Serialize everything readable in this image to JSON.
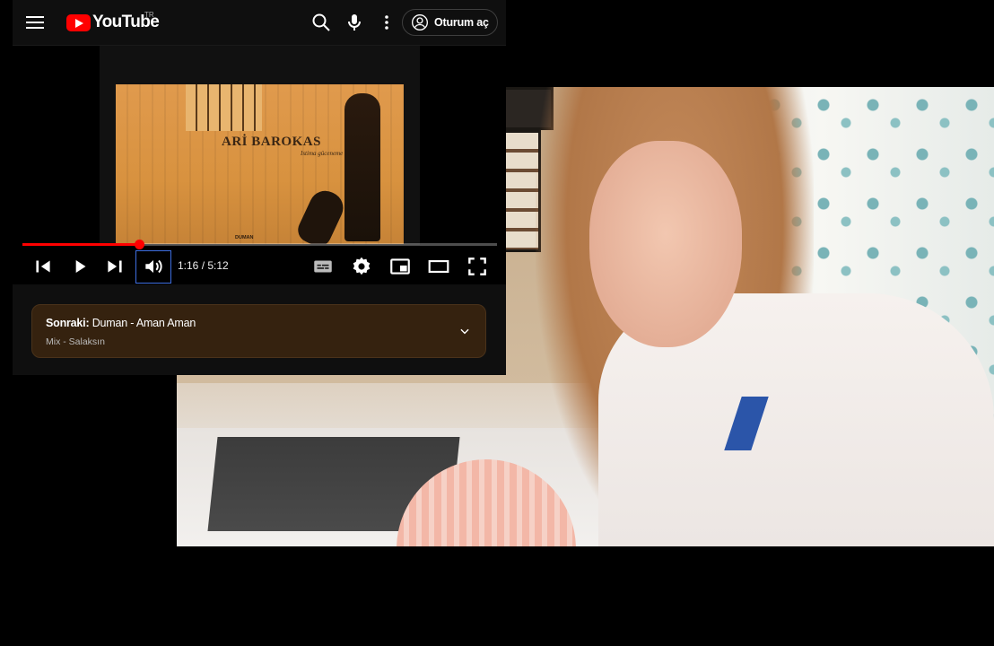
{
  "youtube": {
    "logo_text": "YouTube",
    "country_code": "TR",
    "sign_in_label": "Oturum aç",
    "icons": {
      "menu": "menu-icon",
      "search": "search-icon",
      "mic": "mic-icon",
      "more": "more-vert-icon",
      "account": "account-circle-icon"
    },
    "video": {
      "thumbnail_artist": "ARİ BAROKAS",
      "thumbnail_title": "Istima güceneme",
      "thumbnail_label": "DUMAN",
      "progress_fraction": 0.245,
      "time_display": "1:16 / 5:12"
    },
    "controls": {
      "icons": [
        "skip-previous-icon",
        "play-icon",
        "skip-next-icon",
        "volume-icon",
        "subtitles-icon",
        "settings-icon",
        "miniplayer-icon",
        "theater-icon",
        "fullscreen-icon"
      ]
    },
    "up_next": {
      "prefix": "Sonraki:",
      "title": "Duman - Aman Aman",
      "subtitle": "Mix - Salaksın"
    }
  },
  "colors": {
    "youtube_red": "#ff0000",
    "header_bg": "#0f0f0f",
    "up_next_bg": "#35220f",
    "focus_outline": "#3e6ee0"
  }
}
